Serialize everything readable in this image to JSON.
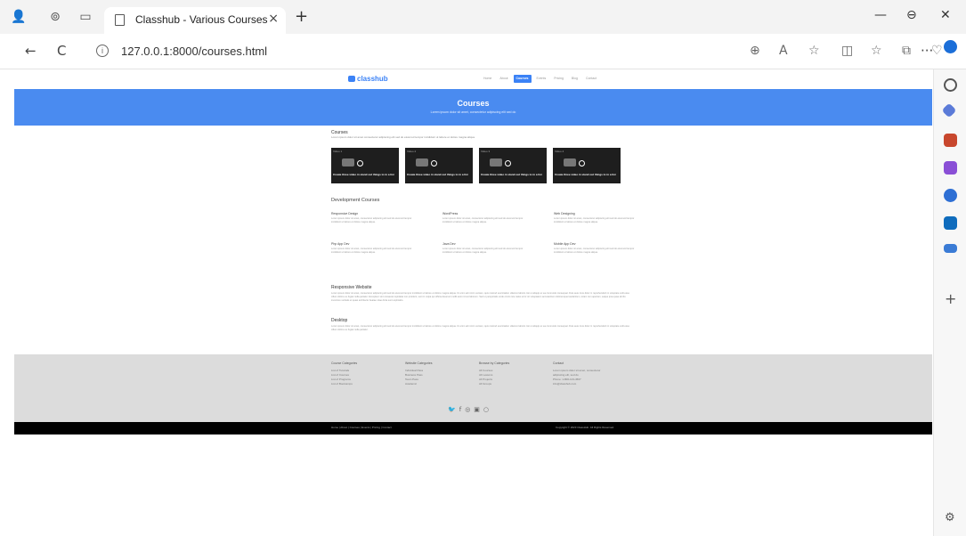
{
  "browser": {
    "tab_title": "Classhub - Various Courses",
    "tab_close": "×",
    "new_tab": "+",
    "url": "127.0.0.1:8000/courses.html",
    "back": "←",
    "refresh": "C",
    "minimize": "—",
    "close": "✕",
    "more": "···"
  },
  "site": {
    "logo": "classhub",
    "menu": [
      {
        "label": "Home",
        "active": false
      },
      {
        "label": "About",
        "active": false
      },
      {
        "label": "Courses",
        "active": true
      },
      {
        "label": "Events",
        "active": false
      },
      {
        "label": "Pricing",
        "active": false
      },
      {
        "label": "Blog",
        "active": false
      },
      {
        "label": "Contact",
        "active": false
      }
    ],
    "hero_title": "Courses",
    "hero_subtitle": "Lorem ipsum dolor sit amet, consectetur adipiscing elit sed do"
  },
  "courses": {
    "title": "Courses",
    "description": "Lorem ipsum dolor sit amet consectetur adipiscing elit sed do eiusmod tempor incididunt ut labore et dolore magna aliqua.",
    "videos": [
      {
        "label": "Video 1",
        "caption": "Create three video in stand out things to in a list"
      },
      {
        "label": "Video 2",
        "caption": "Create three video in stand out things to in a list"
      },
      {
        "label": "Video 3",
        "caption": "Create three video in stand out things to in a list"
      },
      {
        "label": "Video 4",
        "caption": "Create three video in stand out things to in a list"
      }
    ]
  },
  "development": {
    "title": "Development Courses",
    "items": [
      {
        "name": "Responsive Design",
        "text": "Lorem ipsum dolor sit amet, consectetur adipiscing elit sed do eiusmod tempor incididunt ut labore et dolore magna aliqua."
      },
      {
        "name": "WordPress",
        "text": "Lorem ipsum dolor sit amet, consectetur adipiscing elit sed do eiusmod tempor incididunt ut labore et dolore magna aliqua."
      },
      {
        "name": "Web Designing",
        "text": "Lorem ipsum dolor sit amet, consectetur adipiscing elit sed do eiusmod tempor incididunt ut labore et dolore magna aliqua."
      },
      {
        "name": "Php App Dev",
        "text": "Lorem ipsum dolor sit amet, consectetur adipiscing elit sed do eiusmod tempor incididunt ut labore et dolore magna aliqua."
      },
      {
        "name": "Java Dev",
        "text": "Lorem ipsum dolor sit amet, consectetur adipiscing elit sed do eiusmod tempor incididunt ut labore et dolore magna aliqua."
      },
      {
        "name": "Mobile App Dev",
        "text": "Lorem ipsum dolor sit amet, consectetur adipiscing elit sed do eiusmod tempor incididunt ut labore et dolore magna aliqua."
      }
    ]
  },
  "responsive": {
    "title": "Responsive Website",
    "text": "Lorem ipsum dolor sit amet, consectetur adipiscing elit sed do eiusmod tempor incididunt ut labore et dolore magna aliqua. Ut enim ad minim veniam, quis nostrud exercitation ullamco laboris nisi ut aliquip ex ea commodo consequat. Duis aute irure dolor in reprehenderit in voluptate velit esse cillum dolore eu fugiat nulla pariatur. Excepteur sint occaecat cupidatat non proident, sunt in culpa qui officia deserunt mollit anim id est laborum. Sed ut perspiciatis unde omnis iste natus error sit voluptatem accusantium doloremque laudantium, totam rem aperiam, eaque ipsa quae ab illo inventore veritatis et quasi architecto beatae vitae dicta sunt explicabo."
  },
  "desktop": {
    "title": "Desktop",
    "text": "Lorem ipsum dolor sit amet, consectetur adipiscing elit sed do eiusmod tempor incididunt ut labore et dolore magna aliqua. Ut enim ad minim veniam, quis nostrud exercitation ullamco laboris nisi ut aliquip ex ea commodo consequat. Duis aute irure dolor in reprehenderit in voluptate velit esse cillum dolore eu fugiat nulla pariatur."
  },
  "footer": {
    "columns": [
      {
        "head": "Course Categories",
        "links": [
          "List of Tutorials",
          "List of Courses",
          "List of Programs",
          "List of Bootcamps"
        ]
      },
      {
        "head": "Website Categories",
        "links": [
          "Individual Pass",
          "Business Pass",
          "Team Pass",
          "Academic"
        ]
      },
      {
        "head": "Browse by Categories",
        "links": [
          "All Courses",
          "All Lessons",
          "All Projects",
          "All Groups"
        ]
      },
      {
        "head": "Contact",
        "links": [
          "Lorem ipsum dolor sit amet, consectetur",
          "adipiscing elit, sed do",
          "Phone: 1-800-123-4567",
          "info@classhub.com"
        ]
      }
    ],
    "social": [
      "🐦",
      "f",
      "◎",
      "▣",
      "○"
    ],
    "bottom_left": "Home | About | Courses | Events | Pricing | Contact",
    "bottom_right": "Copyright © 2023 ClassHub. All Rights Reserved."
  }
}
